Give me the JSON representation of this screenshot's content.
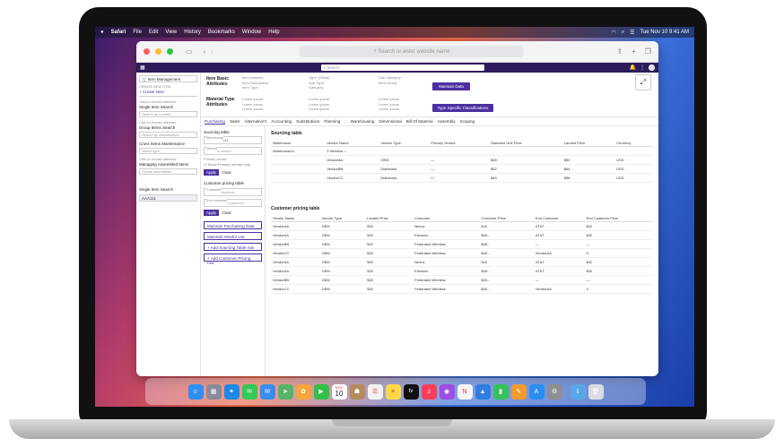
{
  "menubar": {
    "items": [
      "Safari",
      "File",
      "Edit",
      "View",
      "History",
      "Bookmarks",
      "Window",
      "Help"
    ],
    "clock": "Tue Nov 10  9:41 AM"
  },
  "browser": {
    "url_placeholder": "Search or enter website name"
  },
  "app": {
    "search_placeholder": "Search"
  },
  "sidebar": {
    "module": "Item Management",
    "section_label": "CREATE NEW ITEM",
    "create_new": "+ Create New",
    "alt_hint": "Click to choose alternate",
    "single_item_search": "Single Item Search",
    "search_by_number": "Search by number",
    "group_items_search": "Group Items Search",
    "search_by_classification": "Search by classification",
    "cross_items_maintenance": "Cross Items Maintenance",
    "select_type": "Select type",
    "managing_assembled": "Managing Assembled Items",
    "create_assemblies": "Create assemblies",
    "single_item_search_footer": "Single Item Search",
    "selected_item": "AAA111"
  },
  "header": {
    "basic_title": "Item Basic Attributes",
    "basic_labels_1": [
      "Item Number:",
      "Item Description:",
      "Item Type:"
    ],
    "basic_labels_2": [
      "Type: (Small)",
      "Sub Type:",
      "Category:"
    ],
    "basic_labels_3": [
      "Sub Category:",
      "Item Group:"
    ],
    "maintain_data": "Maintain Data",
    "material_title": "Material Type Attributes",
    "lorem": "Lorem ipsum",
    "type_specific": "Type Specific Classifications"
  },
  "tabs": [
    "Purchasing",
    "Sales",
    "Alternative's",
    "Accounting",
    "Substitutions",
    "Planning",
    "Warehousing",
    "Dimensional",
    "Bill Of Material",
    "Assembly",
    "Scoping"
  ],
  "filters": {
    "sourcing_title": "Sourcing table",
    "warehouse_label": "Warehouse",
    "warehouse_value": "Warehouse11",
    "vendor_label": "Vendor",
    "vendor_placeholder": "Select a vendor",
    "primary_vendor_label": "Primary vendor",
    "show_primary": "Show Primary Vendor only",
    "apply": "Apply",
    "clear": "Clear",
    "customer_title": "Customer pricing table",
    "customer_label": "Customer",
    "customer_placeholder": "Select a customer",
    "end_customer_label": "End customer",
    "end_customer_placeholder": "Select an end customer",
    "actions": [
      "Maintain Purchasing Data",
      "Maintain Vendor List",
      "+ Add Sourcing Table row",
      "+ Add Customer Pricing row"
    ]
  },
  "sourcing": {
    "title": "Sourcing table",
    "headers": [
      "Warehouse",
      "Vendor Name",
      "Vendor Type",
      "Primary Vendor",
      "Standard Unit Price",
      "Landed Price",
      "Currency"
    ],
    "rows": [
      [
        "Warehouse11",
        "3 Vendors",
        "",
        "",
        "",
        "",
        ""
      ],
      [
        "",
        "VendorAA",
        "OEM",
        "—",
        "$38",
        "$50",
        "USD"
      ],
      [
        "",
        "VendorBB",
        "Distributor",
        "—",
        "$52",
        "$54",
        "USD"
      ],
      [
        "",
        "VendorCC",
        "Distributor",
        "☐",
        "$49",
        "$58",
        "USD"
      ]
    ]
  },
  "customer": {
    "title": "Customer pricing table",
    "headers": [
      "Vendor Name",
      "Vendor Type",
      "Landed Price",
      "Customer",
      "Customer Price",
      "End Customer",
      "End Customer Price"
    ],
    "rows": [
      [
        "VendorAA",
        "OEM",
        "$30",
        "Nexus",
        "N/A",
        "AT&T",
        "$42"
      ],
      [
        "VendorAA",
        "OEM",
        "$30",
        "Ericsson",
        "$46.-",
        "AT&T",
        "$42"
      ],
      [
        "VendorBB",
        "OEM",
        "$32",
        "Federated Wireless",
        "$45.-",
        "—",
        "—"
      ],
      [
        "VendorCC",
        "OEM",
        "$30",
        "Federated Wireless",
        "$45.-",
        "VendorAA",
        "0"
      ],
      [
        "VendorAA",
        "OEM",
        "$30",
        "Nexus",
        "N/A",
        "AT&T",
        "$42"
      ],
      [
        "VendorAA",
        "OEM",
        "$30",
        "Ericsson",
        "$46.-",
        "AT&T",
        "$42"
      ],
      [
        "VendorBB",
        "OEM",
        "$32",
        "Federated Wireless",
        "$45.-",
        "—",
        "—"
      ],
      [
        "VendorCC",
        "OEM",
        "$30",
        "Federated Wireless",
        "$45.-",
        "VendorAA",
        "0"
      ]
    ]
  },
  "dock": {
    "calendar_month": "NOV",
    "calendar_day": "10",
    "tv_label": "tv",
    "icons": [
      {
        "name": "finder-icon",
        "color": "#2f8ff0",
        "glyph": "☺"
      },
      {
        "name": "launchpad-icon",
        "color": "#8a8a9a",
        "glyph": "▦"
      },
      {
        "name": "safari-icon",
        "color": "#1e88e5",
        "glyph": "✦"
      },
      {
        "name": "messages-icon",
        "color": "#34c759",
        "glyph": "✉"
      },
      {
        "name": "mail-icon",
        "color": "#3d8cf0",
        "glyph": "✉"
      },
      {
        "name": "maps-icon",
        "color": "#58b368",
        "glyph": "➤"
      },
      {
        "name": "photos-icon",
        "color": "#f3a63a",
        "glyph": "✿"
      },
      {
        "name": "facetime-icon",
        "color": "#30c048",
        "glyph": "▶"
      },
      {
        "name": "calendar-icon",
        "color": "#ffffff",
        "glyph": ""
      },
      {
        "name": "contacts-icon",
        "color": "#b38b5d",
        "glyph": "☗"
      },
      {
        "name": "reminders-icon",
        "color": "#f2f2f2",
        "glyph": "☰"
      },
      {
        "name": "notes-icon",
        "color": "#ffd84a",
        "glyph": "≡"
      },
      {
        "name": "appletv-icon",
        "color": "#111111",
        "glyph": ""
      },
      {
        "name": "music-icon",
        "color": "#fa3e5a",
        "glyph": "♫"
      },
      {
        "name": "podcasts-icon",
        "color": "#9b4de0",
        "glyph": "◉"
      },
      {
        "name": "news-icon",
        "color": "#f5f5f5",
        "glyph": "N"
      },
      {
        "name": "keynote-icon",
        "color": "#2f7de0",
        "glyph": "▲"
      },
      {
        "name": "numbers-icon",
        "color": "#35c15b",
        "glyph": "▮"
      },
      {
        "name": "pages-icon",
        "color": "#f39c2e",
        "glyph": "✎"
      },
      {
        "name": "appstore-icon",
        "color": "#2a8cf0",
        "glyph": "A"
      },
      {
        "name": "settings-icon",
        "color": "#8e8e93",
        "glyph": "⚙"
      },
      {
        "name": "downloads-icon",
        "color": "#5aa7e8",
        "glyph": "⇩"
      },
      {
        "name": "trash-icon",
        "color": "#d9dde3",
        "glyph": "🗑"
      }
    ]
  }
}
